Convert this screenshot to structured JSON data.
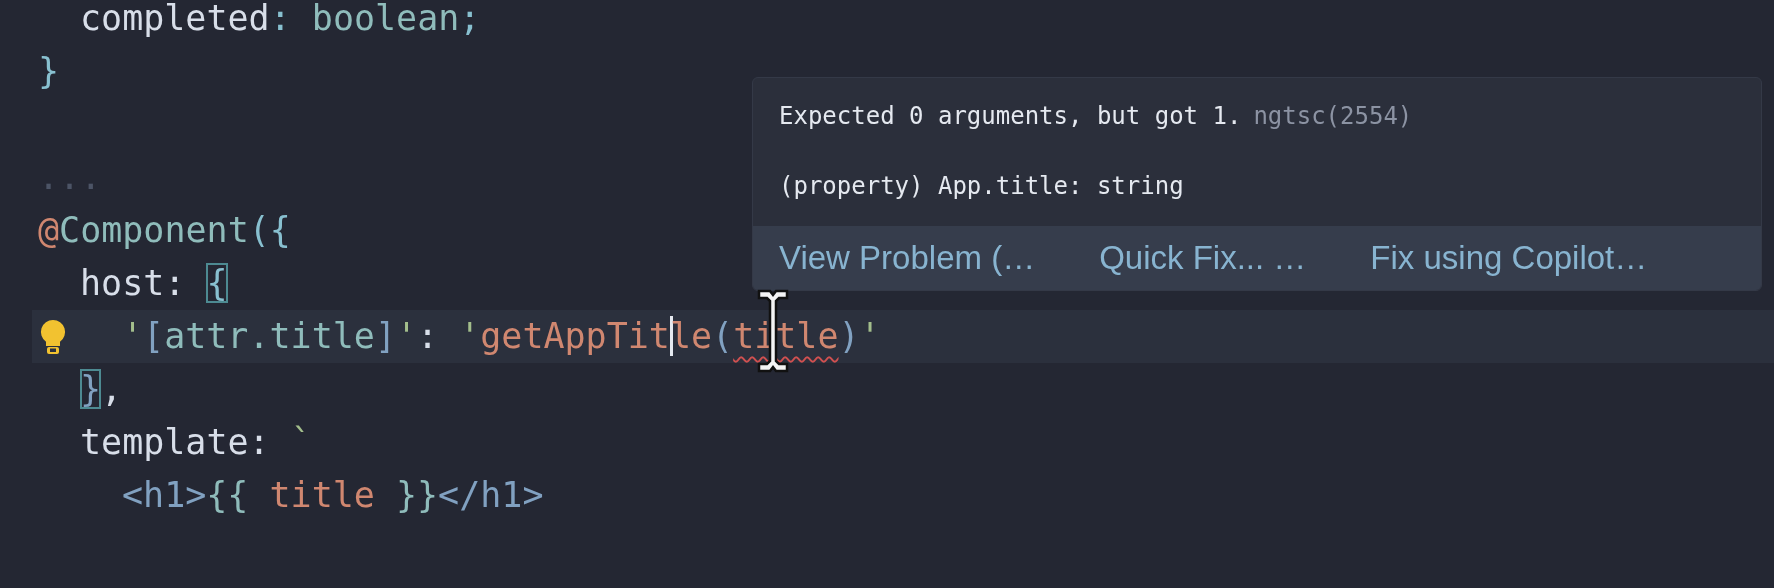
{
  "editor": {
    "lines": [
      {
        "kind": "indented",
        "tokens": [
          {
            "text": "completed",
            "kind": "plain"
          },
          {
            "text": ": ",
            "kind": "punct"
          },
          {
            "text": "boolean",
            "kind": "type"
          },
          {
            "text": ";",
            "kind": "punct"
          }
        ]
      },
      {
        "kind": "code",
        "tokens": [
          {
            "text": "}",
            "kind": "punct"
          }
        ]
      },
      {
        "kind": "blank"
      },
      {
        "kind": "code",
        "tokens": [
          {
            "text": "...",
            "kind": "fold"
          }
        ]
      },
      {
        "kind": "code",
        "tokens": [
          {
            "text": "@",
            "kind": "decorator"
          },
          {
            "text": "Component",
            "kind": "type"
          },
          {
            "text": "({",
            "kind": "punct"
          }
        ]
      },
      {
        "kind": "indented",
        "tokens": [
          {
            "text": "host: ",
            "kind": "plain"
          },
          {
            "text": "{",
            "kind": "punct",
            "match": true
          }
        ]
      },
      {
        "kind": "nested",
        "current": true,
        "lightbulb": true,
        "tokens": [
          {
            "text": "'",
            "kind": "quote"
          },
          {
            "text": "[",
            "kind": "tag"
          },
          {
            "text": "attr.title",
            "kind": "type"
          },
          {
            "text": "]",
            "kind": "tag"
          },
          {
            "text": "'",
            "kind": "quote"
          },
          {
            "text": ": ",
            "kind": "plain"
          },
          {
            "text": "'",
            "kind": "quote"
          },
          {
            "text": "getAppTit",
            "kind": "string",
            "caret": true
          },
          {
            "text": "le",
            "kind": "string"
          },
          {
            "text": "(",
            "kind": "tag"
          },
          {
            "text": "title",
            "kind": "string",
            "error": true
          },
          {
            "text": ")",
            "kind": "tag"
          },
          {
            "text": "'",
            "kind": "quote"
          }
        ]
      },
      {
        "kind": "indented",
        "tokens": [
          {
            "text": "}",
            "kind": "tag",
            "match": true
          },
          {
            "text": ",",
            "kind": "plain"
          }
        ]
      },
      {
        "kind": "indented",
        "tokens": [
          {
            "text": "template: ",
            "kind": "plain"
          },
          {
            "text": "`",
            "kind": "quote"
          }
        ]
      },
      {
        "kind": "nested",
        "tokens": [
          {
            "text": "<h1>",
            "kind": "tag"
          },
          {
            "text": "{{ ",
            "kind": "type"
          },
          {
            "text": "title",
            "kind": "string"
          },
          {
            "text": " }}",
            "kind": "type"
          },
          {
            "text": "</h1>",
            "kind": "tag"
          }
        ]
      }
    ]
  },
  "hover": {
    "message": "Expected 0 arguments, but got 1.",
    "source": "ngtsc(2554)",
    "signature": "(property) App.title: string",
    "actions": [
      "View Problem (…",
      "Quick Fix... …",
      "Fix using Copilot…"
    ]
  }
}
